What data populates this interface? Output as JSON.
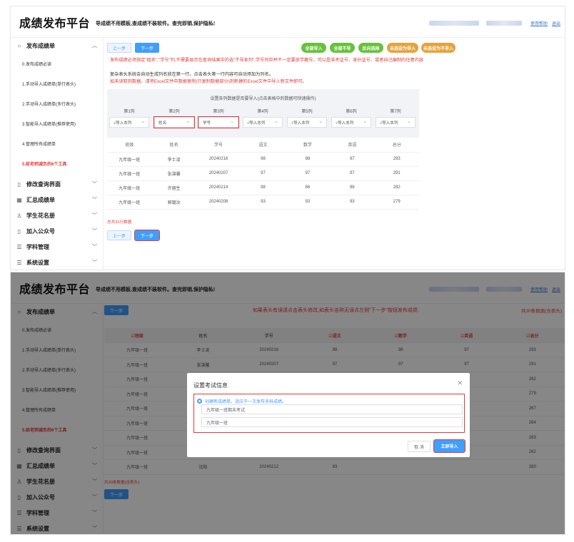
{
  "app": {
    "brand": "成绩发布平台",
    "slogan": "导成绩不用模板,查成绩不装软件。查完即销,保护隐私!",
    "help": "使用帮助",
    "logout": "退出"
  },
  "sidebar": {
    "publish": "发布成绩单",
    "subs": [
      "0.发布成绩必读",
      "1.手动导入成绩单(单行表头)",
      "2.手动导入成绩单(多行表头)",
      "3.智能导入成绩单(推荐使用)",
      "4.管理所有成绩单",
      "5.给老师减负的6个工具"
    ],
    "menus": [
      "修改查询界面",
      "汇总成绩单",
      "学生花名册",
      "加入公众号",
      "学科管理",
      "系统设置"
    ]
  },
  "step1": {
    "prev": "上一步",
    "next": "下一步",
    "actions": [
      "全部导入",
      "全部不导",
      "反向选择",
      "未选设为导入",
      "未选设为不导入"
    ],
    "notes": [
      "发布成绩必须指定\"姓名\",\"学号\"列,不需要显示在查询结果中的选\"不导本列\",学号列中并不一定要放学籍号。可以是准考证号、身份证号、或者自己编制的任意内容",
      "复杂表头系统会自动生成列名放在第一行。点击表头第一行内容可自动添加为列名。",
      "如未读取到数据。请将Excel文件中数据复制(只复制数据部分)到新建的Excel文件中导入新文件即可。"
    ],
    "panel_title": "设置各列数据是否要导入(点击表格中的数据可快速操作)",
    "columns": [
      {
        "title": "第1列",
        "value": "√导入本列"
      },
      {
        "title": "第2列",
        "value": "姓名"
      },
      {
        "title": "第3列",
        "value": "学号"
      },
      {
        "title": "第4列",
        "value": "√导入本列"
      },
      {
        "title": "第5列",
        "value": "√导入本列"
      },
      {
        "title": "第6列",
        "value": "√导入本列"
      },
      {
        "title": "第7列",
        "value": "√导入本列"
      }
    ],
    "headers": [
      "班级",
      "姓名",
      "学号",
      "语文",
      "数学",
      "英语",
      "总分"
    ],
    "rows": [
      [
        "九年级一班",
        "李士凌",
        "20240216",
        "98",
        "98",
        "97",
        "293"
      ],
      [
        "九年级一班",
        "张湛馨",
        "20240207",
        "97",
        "97",
        "97",
        "291"
      ],
      [
        "九年级一班",
        "许丽生",
        "20240214",
        "98",
        "86",
        "98",
        "282"
      ],
      [
        "九年级一班",
        "郭璐汝",
        "20240208",
        "93",
        "93",
        "93",
        "279"
      ]
    ],
    "count": "总共31行数据"
  },
  "step2": {
    "next": "下一步",
    "warning": "如果表头有误请点击表头修改,如表头名称无误点左侧\"下一步\"按钮发布成绩.",
    "total": "共30条数据(含表头)",
    "headers": [
      "☑班级",
      "姓名",
      "学号",
      "☑语文",
      "☑数学",
      "☑英语",
      "☑总分"
    ],
    "rows": [
      [
        "九年级一班",
        "李士凌",
        "20240216",
        "98",
        "98",
        "97",
        "293"
      ],
      [
        "九年级一班",
        "张湛馨",
        "20240207",
        "97",
        "97",
        "97",
        "291"
      ],
      [
        "九年级一班",
        "",
        "",
        "",
        "",
        "",
        "282"
      ],
      [
        "九年级一班",
        "",
        "",
        "",
        "",
        "",
        "279"
      ],
      [
        "九年级一班",
        "",
        "",
        "",
        "",
        "",
        "267"
      ],
      [
        "九年级一班",
        "",
        "",
        "",
        "",
        "",
        "264"
      ],
      [
        "九年级一班",
        "",
        "",
        "",
        "",
        "",
        "263"
      ],
      [
        "九年级一班",
        "",
        "",
        "",
        "",
        "",
        "262"
      ],
      [
        "九年级一班",
        "沈阳",
        "20240212",
        "83",
        "",
        "",
        "260"
      ]
    ],
    "count": "共30条数据(含表头)"
  },
  "dialog": {
    "title": "设置考试信息",
    "radio": "创建新成绩单。适应于一次发布多科成绩。",
    "exam_name": "九年级一班期末考试",
    "class_name": "九年级一班",
    "cancel": "取 消",
    "import": "立即导入"
  }
}
